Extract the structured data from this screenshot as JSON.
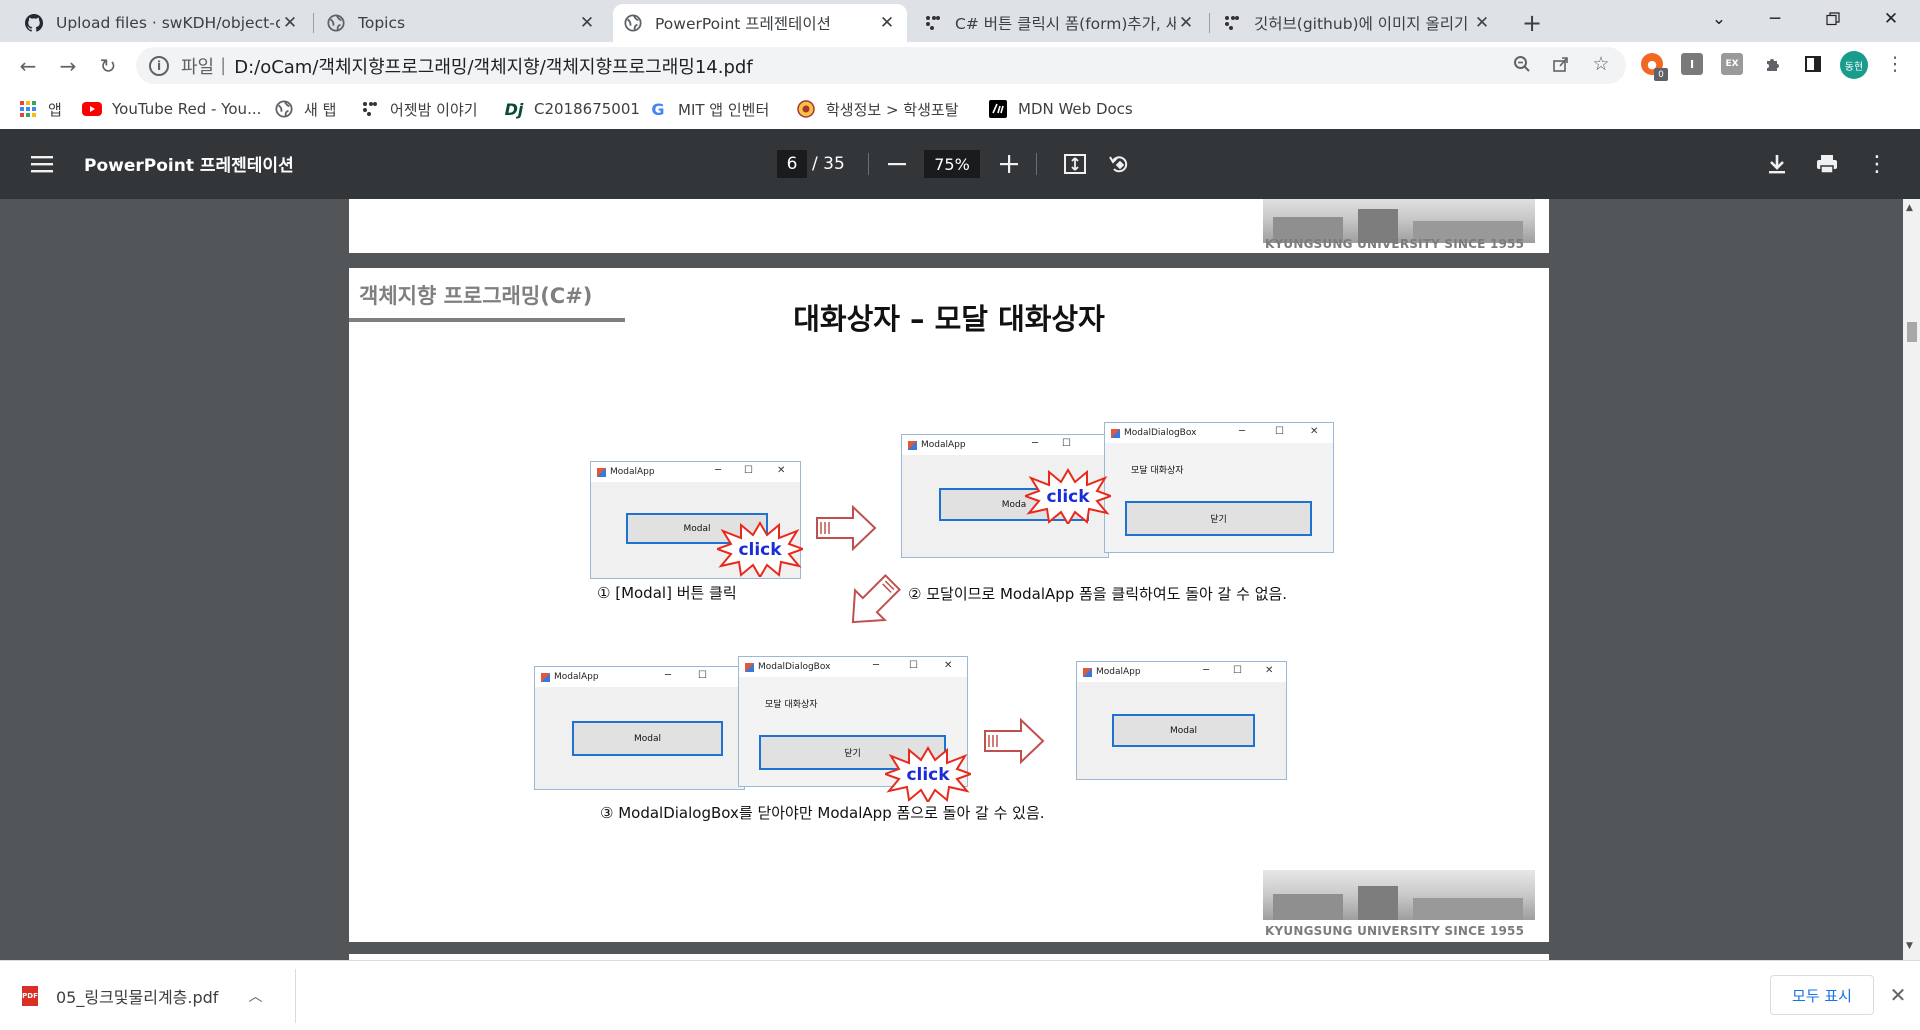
{
  "browser": {
    "tabs": [
      {
        "title": "Upload files · swKDH/object-ori",
        "icon": "github-icon",
        "active": false
      },
      {
        "title": "Topics",
        "icon": "globe-icon",
        "active": false
      },
      {
        "title": "PowerPoint 프레젠테이션",
        "icon": "globe-icon",
        "active": true
      },
      {
        "title": "C# 버튼 클릭시 폼(form)추가, 새",
        "icon": "dots-icon",
        "active": false
      },
      {
        "title": "깃허브(github)에 이미지 올리기",
        "icon": "dots-icon",
        "active": false
      }
    ],
    "new_tab": "+",
    "address": {
      "scheme": "파일",
      "separator": "|",
      "url": "D:/oCam/객체지향프로그래밍/객체지향/객체지향프로그래밍14.pdf"
    },
    "extension_badge": "0",
    "profile_initials": "동현",
    "bookmarks": [
      {
        "label": "앱",
        "icon": "apps-grid-icon"
      },
      {
        "label": "YouTube Red - You...",
        "icon": "youtube-icon"
      },
      {
        "label": "새 탭",
        "icon": "globe-icon"
      },
      {
        "label": "어젯밤 이야기",
        "icon": "dots-icon"
      },
      {
        "label": "C2018675001",
        "icon": "dj-icon"
      },
      {
        "label": "MIT 앱 인벤터",
        "icon": "google-icon"
      },
      {
        "label": "학생정보 > 학생포탈",
        "icon": "school-seal-icon"
      },
      {
        "label": "MDN Web Docs",
        "icon": "mdn-icon"
      }
    ]
  },
  "pdf": {
    "title": "PowerPoint 프레젠테이션",
    "current_page": "6",
    "total_pages": "/ 35",
    "zoom": "75%",
    "university_footer": "KYUNGSUNG UNIVERSITY SINCE 1955"
  },
  "slide": {
    "course": "객체지향 프로그래밍(C#)",
    "title": "대화상자 – 모달 대화상자",
    "windows": {
      "modal_app_title": "ModalApp",
      "modal_dialog_title": "ModalDialogBox",
      "modal_button": "Modal",
      "modal_button_partial": "Moda",
      "dialog_label": "모달 대화상자",
      "close_button": "닫기",
      "click_text": "click"
    },
    "captions": {
      "step1": "① [Modal] 버튼 클릭",
      "step2": "② 모달이므로 ModalApp 폼을 클릭하여도 돌아 갈 수 없음.",
      "step3": "③ ModalDialogBox를 닫아야만 ModalApp 폼으로 돌아 갈 수 있음."
    }
  },
  "downloads": {
    "file": "05_링크및물리계층.pdf",
    "show_all": "모두 표시"
  }
}
